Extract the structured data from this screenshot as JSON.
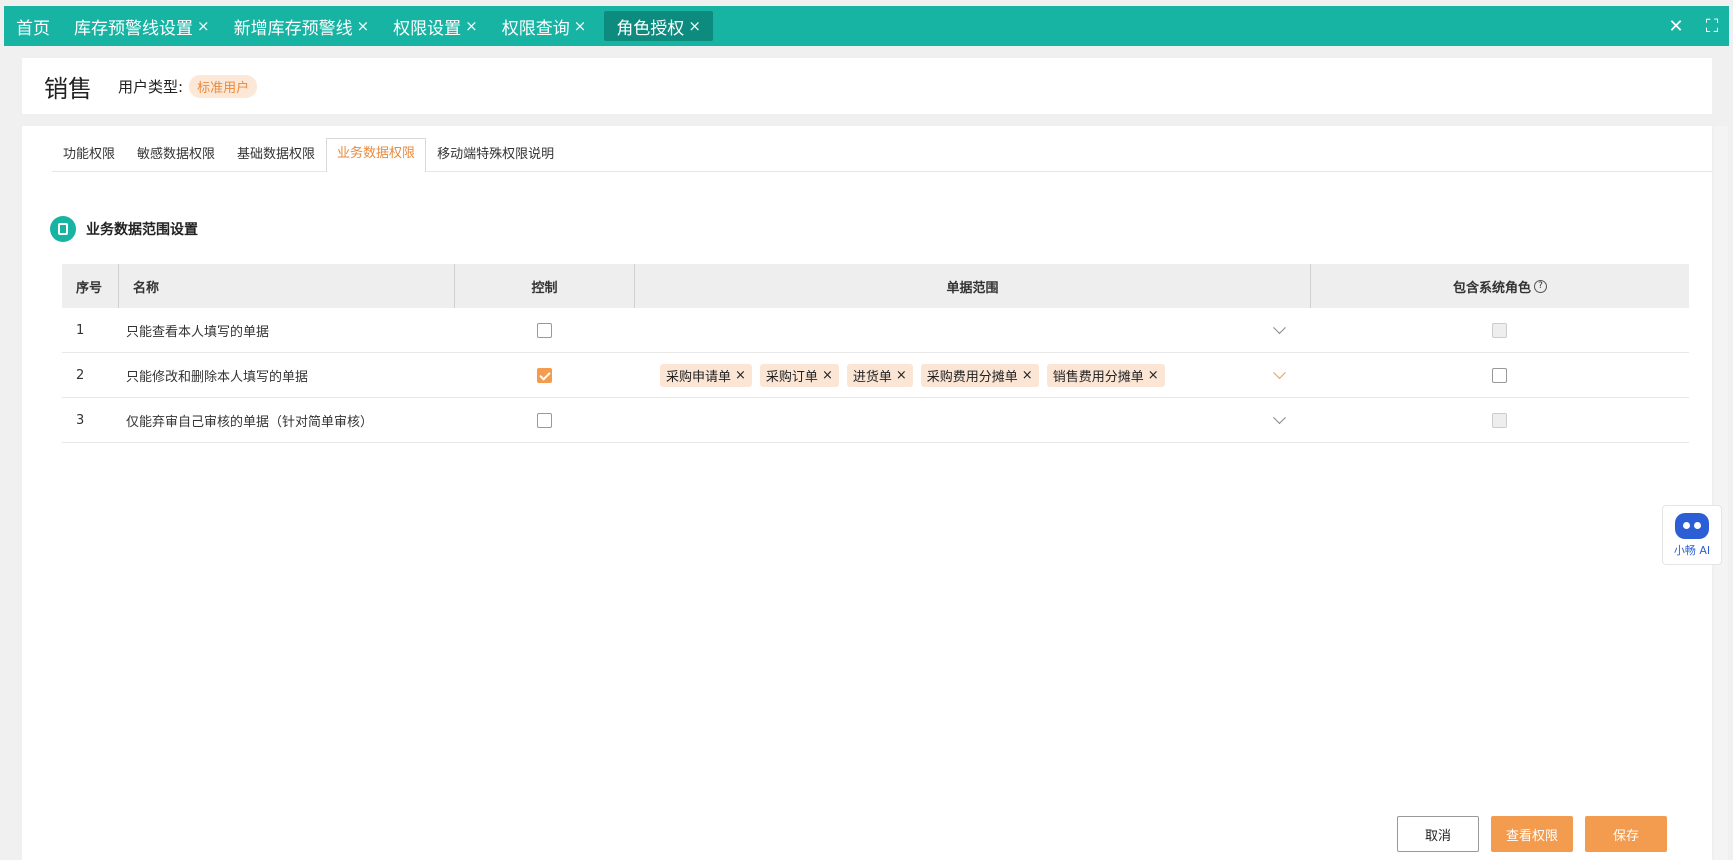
{
  "top_tabs": [
    {
      "label": "首页",
      "closable": false
    },
    {
      "label": "库存预警线设置",
      "closable": true
    },
    {
      "label": "新增库存预警线",
      "closable": true
    },
    {
      "label": "权限设置",
      "closable": true
    },
    {
      "label": "权限查询",
      "closable": true
    },
    {
      "label": "角色授权",
      "closable": true,
      "active": true
    }
  ],
  "close_glyph": "×",
  "header": {
    "role_name": "销售",
    "user_type_label": "用户类型:",
    "user_type_value": "标准用户"
  },
  "sub_tabs": [
    "功能权限",
    "敏感数据权限",
    "基础数据权限",
    "业务数据权限",
    "移动端特殊权限说明"
  ],
  "active_sub_tab": "业务数据权限",
  "section_title": "业务数据范围设置",
  "table": {
    "headers": {
      "no": "序号",
      "name": "名称",
      "control": "控制",
      "range": "单据范围",
      "system_role": "包含系统角色",
      "help": "?"
    },
    "rows": [
      {
        "no": "1",
        "name": "只能查看本人填写的单据",
        "control": false,
        "range": [],
        "system_role": false
      },
      {
        "no": "2",
        "name": "只能修改和删除本人填写的单据",
        "control": true,
        "range": [
          "采购申请单",
          "采购订单",
          "进货单",
          "采购费用分摊单",
          "销售费用分摊单"
        ],
        "system_role": false
      },
      {
        "no": "3",
        "name": "仅能弃审自己审核的单据（针对简单审核）",
        "control": false,
        "range": [],
        "system_role": false
      }
    ]
  },
  "footer": {
    "cancel": "取消",
    "view_permissions": "查看权限",
    "save": "保存"
  },
  "ai_assistant": {
    "label": "小畅 AI"
  },
  "colors": {
    "teal": "#17b3a3",
    "orange": "#f39b4e"
  }
}
